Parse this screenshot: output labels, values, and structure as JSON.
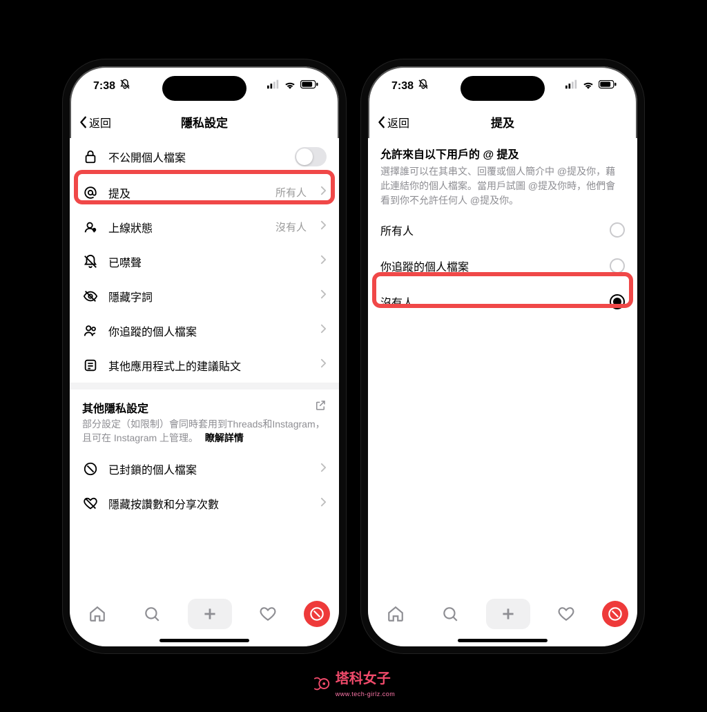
{
  "status": {
    "time": "7:38"
  },
  "left": {
    "back_label": "返回",
    "title": "隱私設定",
    "rows": {
      "private": {
        "label": "不公開個人檔案"
      },
      "mentions": {
        "label": "提及",
        "value": "所有人"
      },
      "online": {
        "label": "上線狀態",
        "value": "沒有人"
      },
      "muted": {
        "label": "已噤聲"
      },
      "hidden_words": {
        "label": "隱藏字詞"
      },
      "following": {
        "label": "你追蹤的個人檔案"
      },
      "suggestions": {
        "label": "其他應用程式上的建議貼文"
      }
    },
    "other_section": {
      "title": "其他隱私設定",
      "subtitle": "部分設定（如限制）會同時套用到Threads和Instagram，且可在 Instagram 上管理。",
      "link": "瞭解詳情"
    },
    "blocked": {
      "label": "已封鎖的個人檔案"
    },
    "hide_likes": {
      "label": "隱藏按讚數和分享次數"
    }
  },
  "right": {
    "back_label": "返回",
    "title": "提及",
    "heading": "允許來自以下用戶的 @ 提及",
    "description": "選擇誰可以在其串文、回覆或個人簡介中 @提及你，藉此連結你的個人檔案。當用戶試圖 @提及你時，他們會看到你不允許任何人 @提及你。",
    "options": {
      "everyone": "所有人",
      "following": "你追蹤的個人檔案",
      "noone": "沒有人"
    }
  },
  "watermark": {
    "main": "塔科女子",
    "sub": "www.tech-girlz.com"
  }
}
